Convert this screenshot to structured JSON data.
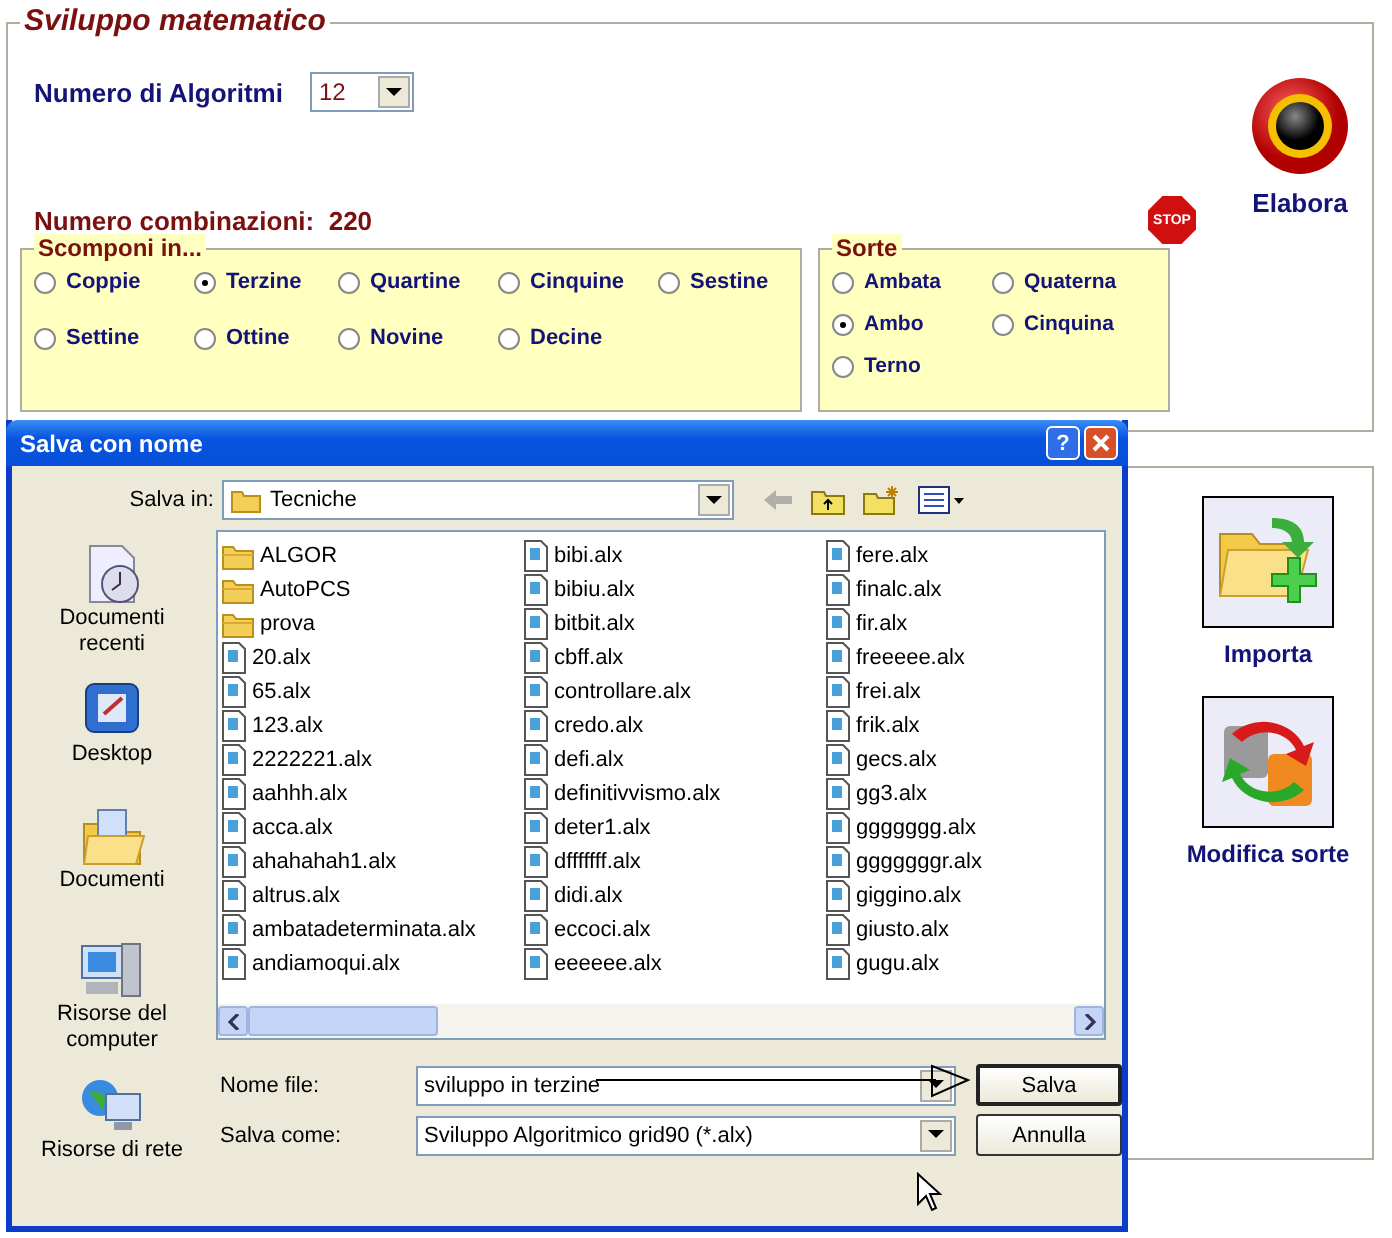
{
  "panel": {
    "title": "Sviluppo matematico",
    "algorithms_label": "Numero di Algoritmi",
    "algorithms_value": "12",
    "combinations_label": "Numero combinazioni:",
    "combinations_value": "220",
    "stop_label": "STOP",
    "elabora_label": "Elabora"
  },
  "scomponi": {
    "title": "Scomponi in...",
    "options": [
      {
        "label": "Coppie",
        "selected": false
      },
      {
        "label": "Terzine",
        "selected": true
      },
      {
        "label": "Quartine",
        "selected": false
      },
      {
        "label": "Cinquine",
        "selected": false
      },
      {
        "label": "Sestine",
        "selected": false
      },
      {
        "label": "Settine",
        "selected": false
      },
      {
        "label": "Ottine",
        "selected": false
      },
      {
        "label": "Novine",
        "selected": false
      },
      {
        "label": "Decine",
        "selected": false
      }
    ]
  },
  "sorte": {
    "title": "Sorte",
    "options": [
      {
        "label": "Ambata",
        "selected": false
      },
      {
        "label": "Quaterna",
        "selected": false
      },
      {
        "label": "Ambo",
        "selected": true
      },
      {
        "label": "Cinquina",
        "selected": false
      },
      {
        "label": "Terno",
        "selected": false
      }
    ]
  },
  "actions": [
    {
      "kind": "import",
      "label": "Importa"
    },
    {
      "kind": "modify",
      "label": "Modifica sorte"
    }
  ],
  "dialog": {
    "title": "Salva con nome",
    "help_label": "?",
    "save_in_label": "Salva in:",
    "save_in_value": "Tecniche",
    "places": [
      {
        "kind": "recent",
        "label": "Documenti recenti"
      },
      {
        "kind": "desktop",
        "label": "Desktop"
      },
      {
        "kind": "documents",
        "label": "Documenti"
      },
      {
        "kind": "computer",
        "label": "Risorse del computer"
      },
      {
        "kind": "network",
        "label": "Risorse di rete"
      }
    ],
    "files": [
      {
        "kind": "folder",
        "name": "ALGOR"
      },
      {
        "kind": "folder",
        "name": "AutoPCS"
      },
      {
        "kind": "folder",
        "name": "prova"
      },
      {
        "kind": "file",
        "name": "20.alx"
      },
      {
        "kind": "file",
        "name": "65.alx"
      },
      {
        "kind": "file",
        "name": "123.alx"
      },
      {
        "kind": "file",
        "name": "2222221.alx"
      },
      {
        "kind": "file",
        "name": "aahhh.alx"
      },
      {
        "kind": "file",
        "name": "acca.alx"
      },
      {
        "kind": "file",
        "name": "ahahahah1.alx"
      },
      {
        "kind": "file",
        "name": "altrus.alx"
      },
      {
        "kind": "file",
        "name": "ambatadeterminata.alx"
      },
      {
        "kind": "file",
        "name": "andiamoqui.alx"
      },
      {
        "kind": "file",
        "name": "bibi.alx"
      },
      {
        "kind": "file",
        "name": "bibiu.alx"
      },
      {
        "kind": "file",
        "name": "bitbit.alx"
      },
      {
        "kind": "file",
        "name": "cbff.alx"
      },
      {
        "kind": "file",
        "name": "controllare.alx"
      },
      {
        "kind": "file",
        "name": "credo.alx"
      },
      {
        "kind": "file",
        "name": "defi.alx"
      },
      {
        "kind": "file",
        "name": "definitivvismo.alx"
      },
      {
        "kind": "file",
        "name": "deter1.alx"
      },
      {
        "kind": "file",
        "name": "dfffffff.alx"
      },
      {
        "kind": "file",
        "name": "didi.alx"
      },
      {
        "kind": "file",
        "name": "eccoci.alx"
      },
      {
        "kind": "file",
        "name": "eeeeee.alx"
      },
      {
        "kind": "file",
        "name": "fere.alx"
      },
      {
        "kind": "file",
        "name": "finalc.alx"
      },
      {
        "kind": "file",
        "name": "fir.alx"
      },
      {
        "kind": "file",
        "name": "freeeee.alx"
      },
      {
        "kind": "file",
        "name": "frei.alx"
      },
      {
        "kind": "file",
        "name": "frik.alx"
      },
      {
        "kind": "file",
        "name": "gecs.alx"
      },
      {
        "kind": "file",
        "name": "gg3.alx"
      },
      {
        "kind": "file",
        "name": "ggggggg.alx"
      },
      {
        "kind": "file",
        "name": "gggggggr.alx"
      },
      {
        "kind": "file",
        "name": "giggino.alx"
      },
      {
        "kind": "file",
        "name": "giusto.alx"
      },
      {
        "kind": "file",
        "name": "gugu.alx"
      }
    ],
    "filename_label": "Nome file:",
    "filename_value": "sviluppo in terzine",
    "filetype_label": "Salva come:",
    "filetype_value": "Sviluppo Algoritmico grid90 (*.alx)",
    "buttons": [
      "Salva",
      "Annulla"
    ]
  }
}
